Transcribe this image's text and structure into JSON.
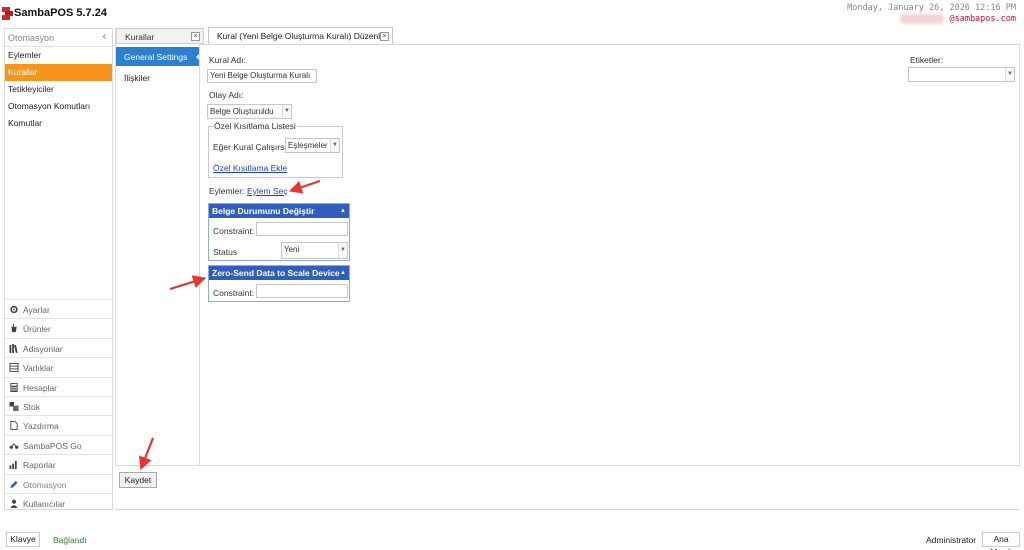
{
  "app": {
    "title": "SambaPOS 5.7.24",
    "datetime": "Monday, January 26, 2026 12:16 PM",
    "email": "@sambapos.com"
  },
  "left_panel": {
    "header": "Otomasyon",
    "collapse_glyph": "‹",
    "items": [
      {
        "label": "Eylemler"
      },
      {
        "label": "Kurallar"
      },
      {
        "label": "Tetikleyiciler"
      },
      {
        "label": "Otomasyon Komutları"
      },
      {
        "label": "Komutlar"
      }
    ],
    "modules": [
      {
        "label": "Ayarlar",
        "icon": "gear-icon"
      },
      {
        "label": "Ürünler",
        "icon": "cup-icon"
      },
      {
        "label": "Adisyonlar",
        "icon": "books-icon"
      },
      {
        "label": "Varlıklar",
        "icon": "table-icon"
      },
      {
        "label": "Hesaplar",
        "icon": "calculator-icon"
      },
      {
        "label": "Stok",
        "icon": "boxes-icon"
      },
      {
        "label": "Yazdırma",
        "icon": "document-icon"
      },
      {
        "label": "SambaPOS Go",
        "icon": "bike-icon"
      },
      {
        "label": "Raporlar",
        "icon": "bar-chart-icon"
      },
      {
        "label": "Otomasyon",
        "icon": "pencil-icon"
      },
      {
        "label": "Kullanıcılar",
        "icon": "user-icon"
      }
    ]
  },
  "rules_panel": {
    "tab_label": "Kurallar",
    "items": [
      {
        "label": "General Settings"
      },
      {
        "label": "İlişkiler"
      }
    ]
  },
  "editor": {
    "tab_label": "Kural (Yeni Belge Oluşturma Kuralı) Düzenle",
    "rule_name_label": "Kural Adı:",
    "rule_name_value": "Yeni Belge Oluşturma Kuralı",
    "event_label": "Olay Adı:",
    "event_value": "Belge Oluşturuldu",
    "constraints_group_label": "Özel Kısıtlama Listesi",
    "execute_if_label": "Eğer Kural Çalışırsa",
    "execute_if_value": "Eşleşmeler",
    "add_constraint_link": "Özel Kısıtlama Ekle",
    "actions_label": "Eylemler:",
    "select_action_link": "Eylem Seç",
    "tags_label": "Etiketler:",
    "tags_value": ""
  },
  "actions": [
    {
      "title": "Belge Durumunu Değiştir",
      "constraint_label": "Constraint:",
      "constraint_value": "",
      "status_label": "Status",
      "status_value": "Yeni"
    },
    {
      "title": "Zero-Send Data to Scale Device",
      "constraint_label": "Constraint:",
      "constraint_value": ""
    }
  ],
  "footer": {
    "save_label": "Kaydet"
  },
  "statusbar": {
    "keyboard_label": "Klavye",
    "connection_status": "Bağlandı",
    "user": "Administrator",
    "main_menu_label": "Ana Menü"
  },
  "colors": {
    "accent_orange": "#f7941d",
    "selection_blue": "#2d7fcf",
    "action_header_blue": "#2f5ebd",
    "link_blue": "#1a3fcf",
    "status_green": "#2b8a2b",
    "annotation_red": "#e8332f"
  }
}
